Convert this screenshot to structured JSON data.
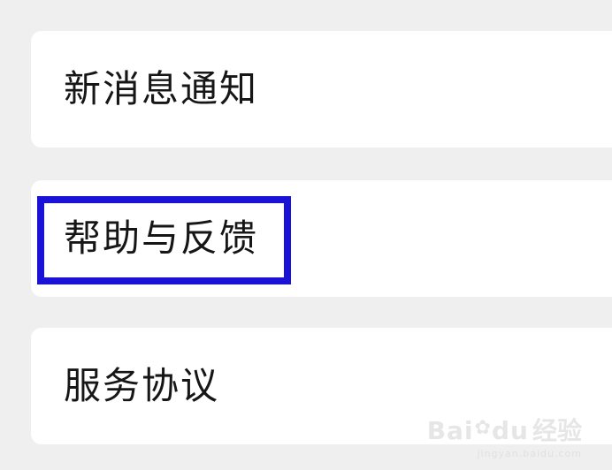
{
  "settings": {
    "items": [
      {
        "label": "新消息通知"
      },
      {
        "label": "帮助与反馈"
      },
      {
        "label": "服务协议"
      }
    ]
  },
  "annotation": {
    "highlight_color": "#1a12d6"
  },
  "watermark": {
    "brand_left": "Bai",
    "brand_icon": "paw-icon",
    "brand_right": "du",
    "suffix": "经验",
    "url": "jingyan.baidu.com"
  }
}
